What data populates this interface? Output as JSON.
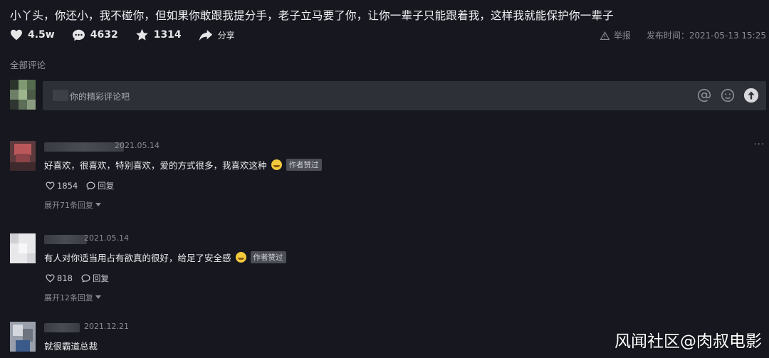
{
  "post": {
    "title": "小丫头，你还小，我不碰你，但如果你敢跟我提分手，老子立马要了你，让你一辈子只能跟着我，这样我就能保护你一辈子",
    "likes": "4.5w",
    "comments": "4632",
    "favorites": "1314",
    "share_label": "分享",
    "report_label": "举报",
    "publish_time": "发布时间：2021-05-13 15:25"
  },
  "section": {
    "label": "全部评论"
  },
  "comment_box": {
    "placeholder": "你的精彩评论吧"
  },
  "comments": [
    {
      "date": "2021.05.14",
      "text": "好喜欢，很喜欢，特别喜欢，爱的方式很多，我喜欢这种",
      "badge": "作者赞过",
      "likes": "1854",
      "reply_label": "回复",
      "expand_label": "展开71条回复"
    },
    {
      "date": "2021.05.14",
      "text": "有人对你适当用占有欲真的很好，给足了安全感",
      "badge": "作者赞过",
      "likes": "818",
      "reply_label": "回复",
      "expand_label": "展开12条回复"
    },
    {
      "date": "2021.12.21",
      "text": "就很霸道总裁"
    }
  ],
  "watermark": "风闻社区@肉叔电影",
  "colors": {
    "background": "#16171f",
    "input": "#2e3037",
    "muted": "#8d8e95",
    "badge": "#4c4e56"
  }
}
